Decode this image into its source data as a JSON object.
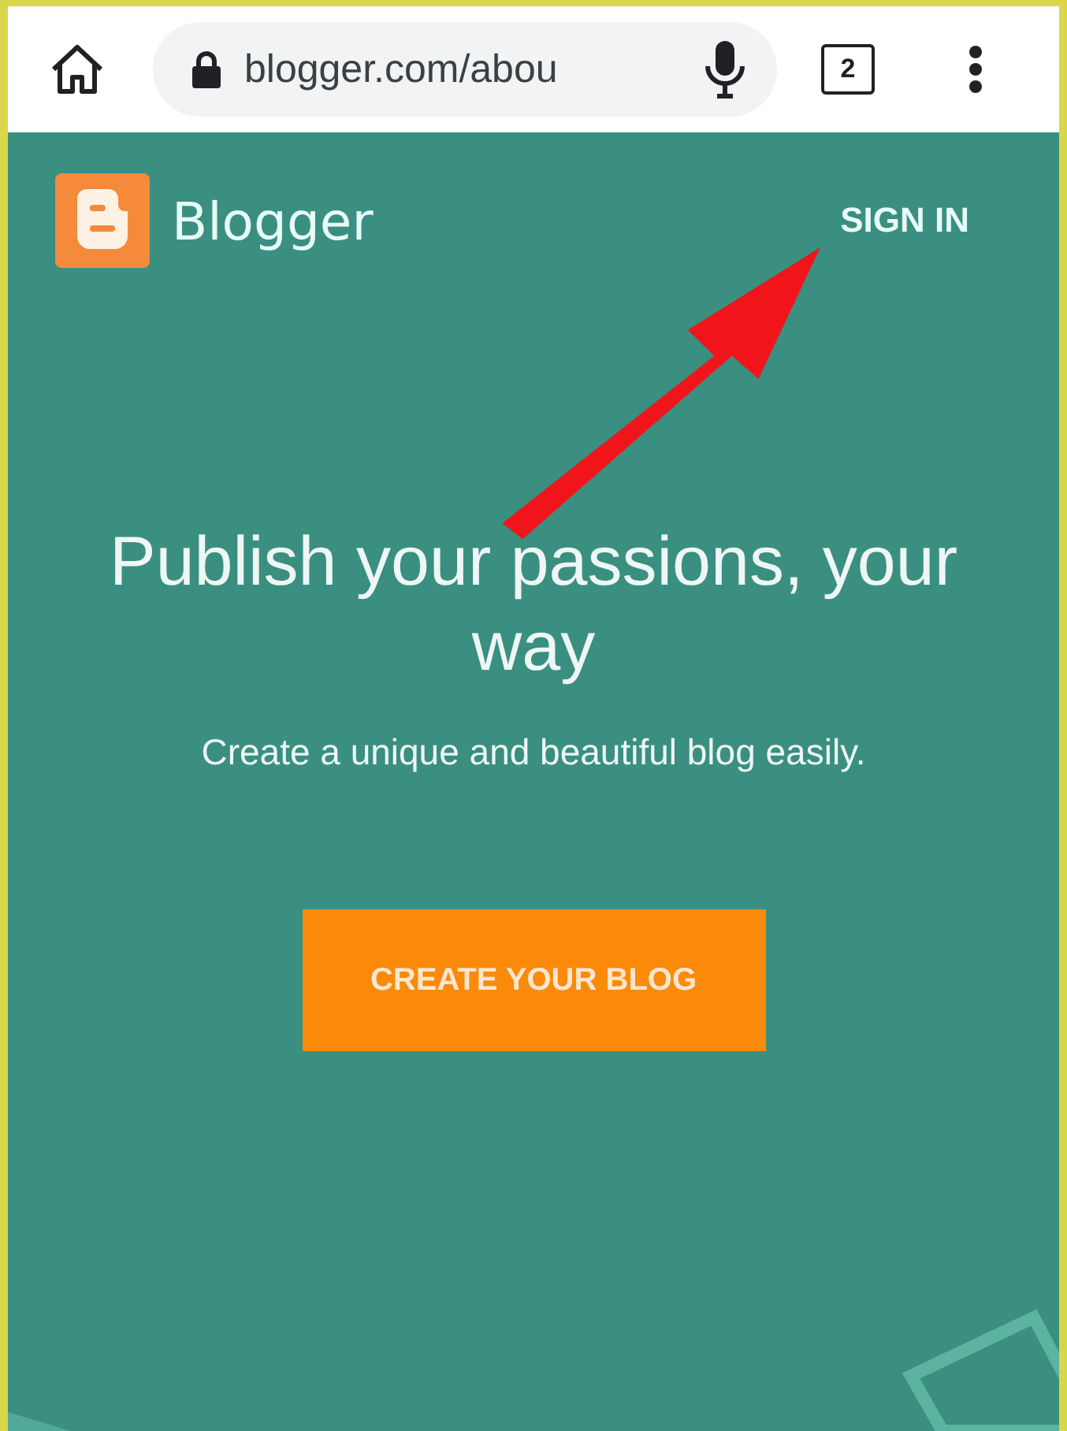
{
  "browser": {
    "url": "blogger.com/abou",
    "tab_count": "2"
  },
  "header": {
    "brand": "Blogger",
    "sign_in": "SIGN IN"
  },
  "hero": {
    "headline": "Publish your passions, your way",
    "subtitle": "Create a unique and beautiful blog easily.",
    "button": "CREATE YOUR BLOG"
  }
}
